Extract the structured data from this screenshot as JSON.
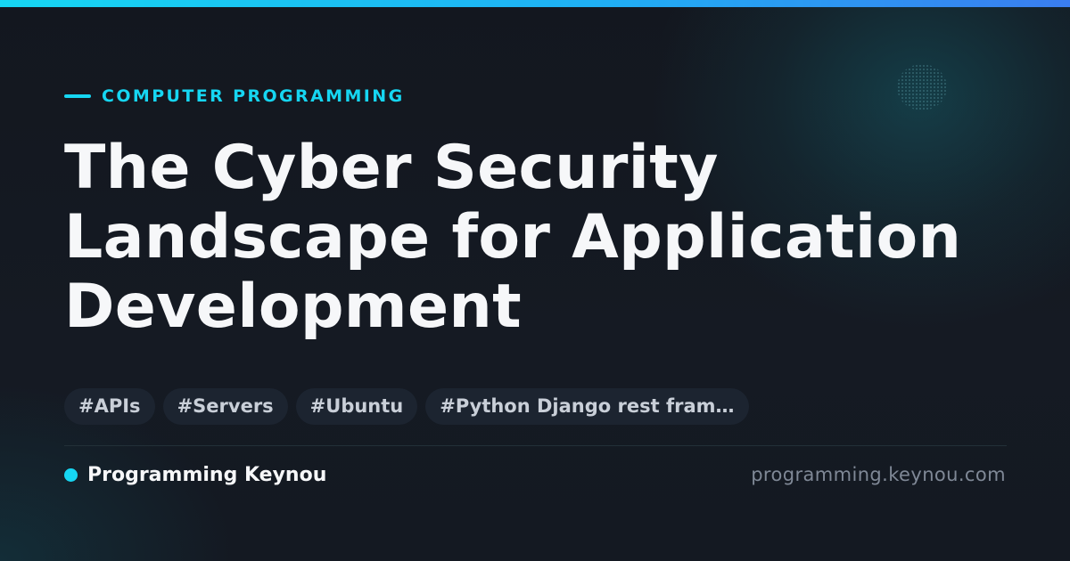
{
  "colors": {
    "accent": "#16d6f2",
    "background": "#141922",
    "title": "#f6f7f9",
    "tag_background": "#1c2430",
    "tag_text": "#c9cfd8",
    "url_text": "#7f8896"
  },
  "header": {
    "category": "COMPUTER PROGRAMMING"
  },
  "article": {
    "title_lines": [
      "The Cyber Security",
      "Landscape for Application",
      "Development"
    ]
  },
  "tags": [
    "#APIs",
    "#Servers",
    "#Ubuntu",
    "#Python Django rest fram…"
  ],
  "footer": {
    "brand_name": "Programming Keynou",
    "site_url": "programming.keynou.com"
  }
}
